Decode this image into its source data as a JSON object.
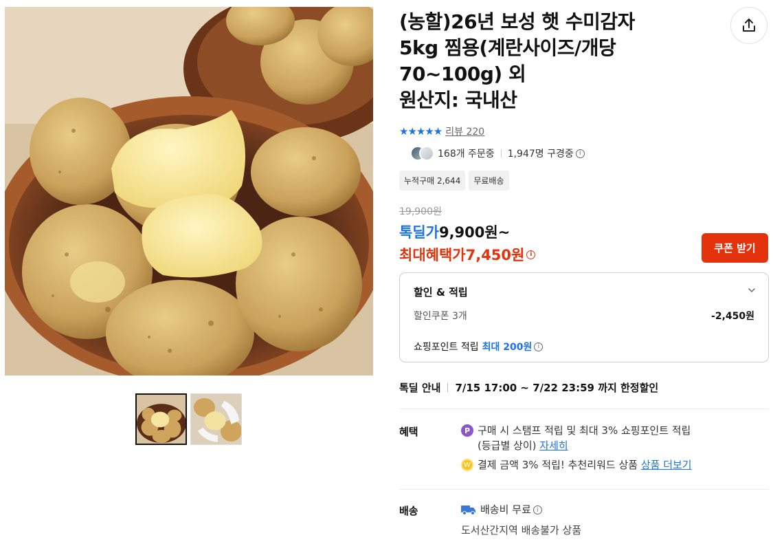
{
  "product": {
    "title_lines": [
      "(농할)26년 보성 햇 수미감자",
      "5kg 찜용(계란사이즈/개당",
      "70~100g) 외",
      "원산지: 국내산"
    ],
    "stars": "★★★★★",
    "review_label": "리뷰 220",
    "orders_text": "168개 주문중",
    "viewers_text": "1,947명 구경중",
    "tags": [
      "누적구매 2,644",
      "무료배송"
    ]
  },
  "price": {
    "original": "19,900원",
    "deal_label": "톡딜가",
    "deal_value": "9,900원~",
    "max_label": "최대혜택가",
    "max_value": "7,450원",
    "coupon_button": "쿠폰 받기"
  },
  "benefit_box": {
    "title": "할인 & 적립",
    "coupon_label": "할인쿠폰 3개",
    "coupon_value": "-2,450원",
    "point_label": "쇼핑포인트 적립",
    "point_value": "최대 200원"
  },
  "deal_info": {
    "label": "톡딜 안내",
    "period": "7/15 17:00 ~ 7/22 23:59 까지 한정할인"
  },
  "benefits": {
    "label": "혜택",
    "line1": "구매 시 스탬프 적립 및 최대 3% 쇼핑포인트 적립",
    "line1b": "(등급별 상이)",
    "line1_link": "자세히",
    "line2": "결제 금액 3% 적립! 추천리워드 상품",
    "line2_link": "상품 더보기",
    "p_icon": "P",
    "coin_icon": "W"
  },
  "shipping": {
    "label": "배송",
    "fee": "배송비 무료",
    "note": "도서산간지역 배송불가 상품"
  },
  "icons": {
    "share": "share-icon",
    "info": "i",
    "chevron": "chevron-down-icon",
    "truck": "truck-icon"
  },
  "colors": {
    "accent_blue": "#1a73e8",
    "accent_red": "#e4320c",
    "star": "#1a73e8"
  }
}
